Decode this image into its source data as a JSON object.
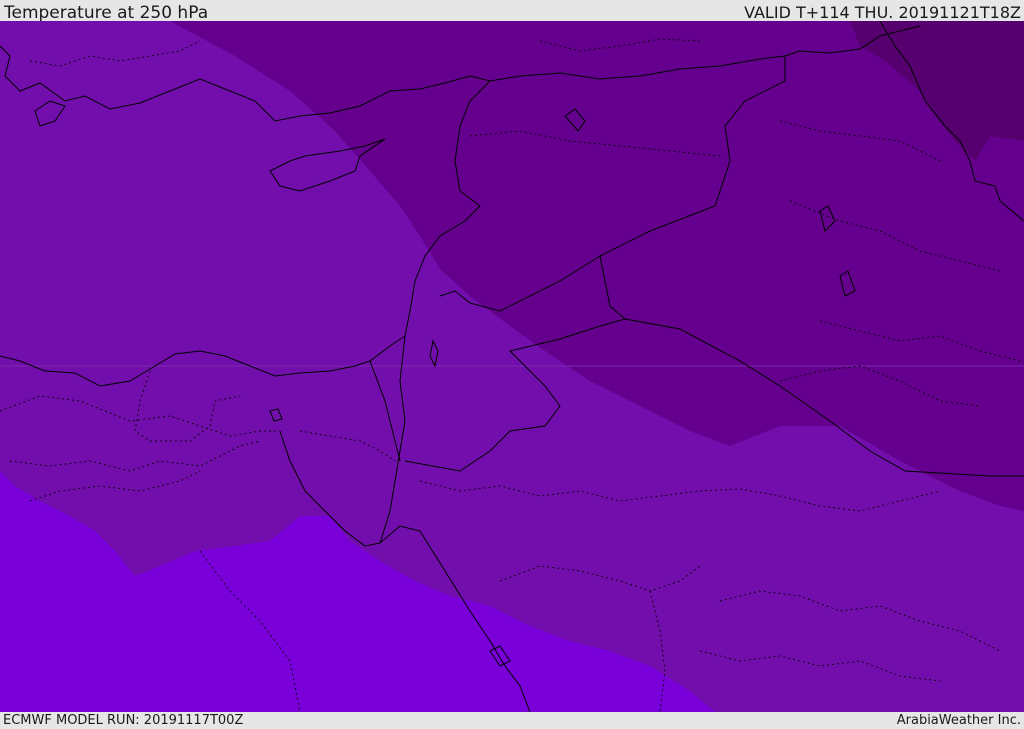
{
  "header": {
    "title": "Temperature at 250 hPa",
    "valid": "VALID T+114 THU. 20191121T18Z"
  },
  "footer": {
    "model_run": "ECMWF MODEL RUN: 20191117T00Z",
    "brand": "ArabiaWeather Inc."
  },
  "map": {
    "variable": "temperature",
    "level": "250 hPa",
    "colors": {
      "coldest": "#56006f",
      "cold": "#64008d",
      "mid": "#720fac",
      "warm": "#7900d9",
      "coast": "#000000"
    }
  }
}
